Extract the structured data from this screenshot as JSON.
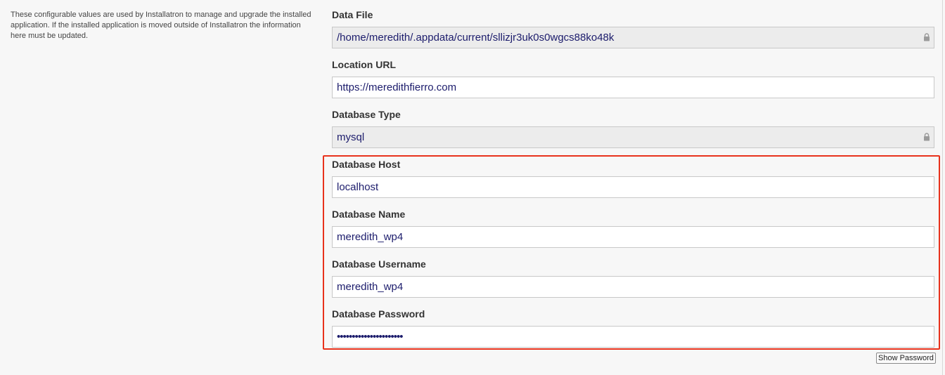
{
  "description": "These configurable values are used by Installatron to manage and upgrade the installed application. If the installed application is moved outside of Installatron the information here must be updated.",
  "fields": {
    "data_file": {
      "label": "Data File",
      "value": "/home/meredith/.appdata/current/sllizjr3uk0s0wgcs88ko48k",
      "locked": true
    },
    "location_url": {
      "label": "Location URL",
      "value": "https://meredithfierro.com",
      "locked": false
    },
    "database_type": {
      "label": "Database Type",
      "value": "mysql",
      "locked": true
    },
    "database_host": {
      "label": "Database Host",
      "value": "localhost",
      "locked": false
    },
    "database_name": {
      "label": "Database Name",
      "value": "meredith_wp4",
      "locked": false
    },
    "database_username": {
      "label": "Database Username",
      "value": "meredith_wp4",
      "locked": false
    },
    "database_password": {
      "label": "Database Password",
      "value": "••••••••••••••••••••••",
      "locked": false
    }
  },
  "show_password_label": "Show Password",
  "colors": {
    "highlight": "#e8321c",
    "input_text": "#1c1c6c",
    "locked_background": "#ececec"
  },
  "icons": {
    "lock": "lock-icon"
  }
}
